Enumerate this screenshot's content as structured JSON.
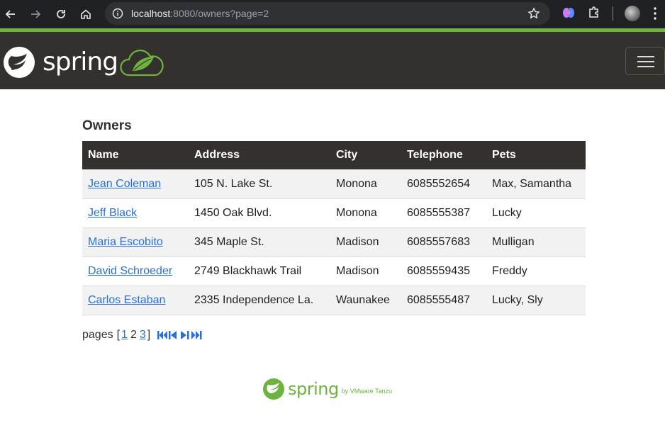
{
  "browser": {
    "url_host": "localhost",
    "url_rest": ":8080/owners?page=2"
  },
  "app": {
    "brand": "spring"
  },
  "page": {
    "heading": "Owners",
    "columns": [
      "Name",
      "Address",
      "City",
      "Telephone",
      "Pets"
    ],
    "owners": [
      {
        "name": "Jean Coleman",
        "address": "105 N. Lake St.",
        "city": "Monona",
        "telephone": "6085552654",
        "pets": "Max, Samantha"
      },
      {
        "name": "Jeff Black",
        "address": "1450 Oak Blvd.",
        "city": "Monona",
        "telephone": "6085555387",
        "pets": "Lucky"
      },
      {
        "name": "Maria Escobito",
        "address": "345 Maple St.",
        "city": "Madison",
        "telephone": "6085557683",
        "pets": "Mulligan"
      },
      {
        "name": "David Schroeder",
        "address": "2749 Blackhawk Trail",
        "city": "Madison",
        "telephone": "6085559435",
        "pets": "Freddy"
      },
      {
        "name": "Carlos Estaban",
        "address": "2335 Independence La.",
        "city": "Waunakee",
        "telephone": "6085555487",
        "pets": "Lucky, Sly"
      }
    ]
  },
  "pagination": {
    "label": "pages",
    "open": "[",
    "close": "]",
    "pages": [
      "1",
      "2",
      "3"
    ],
    "current": "2"
  },
  "footer": {
    "brand": "spring",
    "by": "by VMware Tanzu"
  },
  "colors": {
    "accent": "#6db33f",
    "navbar": "#34302d",
    "link": "#2a6fd6"
  },
  "icons": [
    "back-arrow-icon",
    "forward-arrow-icon",
    "reload-icon",
    "home-icon",
    "site-info-icon",
    "bookmark-star-icon",
    "extension-icon",
    "puzzle-icon",
    "menu-dots-icon",
    "spring-logo-icon",
    "hamburger-icon",
    "first-page-icon",
    "prev-page-icon",
    "next-page-icon",
    "last-page-icon"
  ]
}
